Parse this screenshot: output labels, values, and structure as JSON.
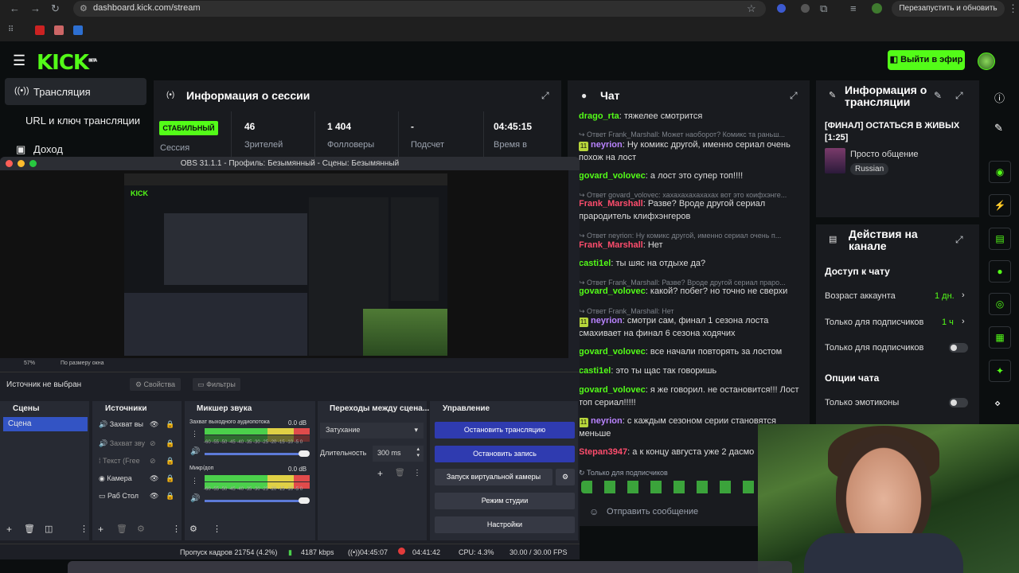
{
  "browser": {
    "url": "dashboard.kick.com/stream",
    "restart_label": "Перезапустить и обновить"
  },
  "kick": {
    "logo": "KICK",
    "logo_badge": "BETA",
    "go_live": "Выйти в эфир"
  },
  "nav": {
    "items": [
      {
        "label": "Трансляция",
        "icon": "broadcast-icon"
      },
      {
        "label": "URL и ключ трансляции"
      },
      {
        "label": "Доход",
        "icon": "money-icon"
      }
    ]
  },
  "session": {
    "title": "Информация о сессии",
    "status": "СТАБИЛЬНЫЙ",
    "status_label": "Сессия",
    "stats": [
      {
        "value": "46",
        "label": "Зрителей"
      },
      {
        "value": "1 404",
        "label": "Фолловеры"
      },
      {
        "value": "-",
        "label": "Подсчет"
      },
      {
        "value": "04:45:15",
        "label": "Время в"
      }
    ]
  },
  "chat": {
    "title": "Чат",
    "send_placeholder": "Отправить сообщение",
    "subs_only_note": "Только для подписчиков",
    "messages": [
      {
        "user": "drago_rta",
        "text": "тяжелее смотрится"
      },
      {
        "reply": "Ответ Frank_Marshall: Может наоборот? Комикс та раньш...",
        "badge": "11",
        "user": "neyrion",
        "text": "Ну комикс другой, именно сериал очень похож на лост"
      },
      {
        "user": "govard_volovec",
        "text": "а лост это супер топ!!!!"
      },
      {
        "reply": "Ответ govard_volovec: хахахахахахахах вот это коифхэнге...",
        "user": "Frank_Marshall",
        "text": "Разве? Вроде другой сериал прародитель клифхэнгеров"
      },
      {
        "reply": "Ответ neyrion: Ну комикс другой, именно сериал очень п...",
        "user": "Frank_Marshall",
        "text": "Нет"
      },
      {
        "user": "casti1el",
        "text": "ты шяс на отдыхе да?"
      },
      {
        "reply": "Ответ Frank_Marshall: Разве? Вроде другой сериал прaро...",
        "user": "govard_volovec",
        "text": "какой? побег? но точно не сверхи"
      },
      {
        "reply": "Ответ Frank_Marshall: Нет",
        "badge": "11",
        "user": "neyrion",
        "text": "смотри сам, финал 1 сезона лоста смахивает на финал 6 сезона ходячих"
      },
      {
        "user": "govard_volovec",
        "text": "все начали повторять за лостом"
      },
      {
        "user": "casti1el",
        "text": "это ты щас так говоришь"
      },
      {
        "user": "govard_volovec",
        "text": "я же говорил. не остановится!!! Лост топ сериал!!!!!"
      },
      {
        "badge": "11",
        "user": "neyrion",
        "text": "с каждым сезоном серии становятся меньше"
      },
      {
        "user": "Stepan3947",
        "text": "а к концу августа уже 2 дасмо"
      }
    ]
  },
  "stream_info": {
    "title": "Информация о трансляции",
    "stream_title": "[ФИНАЛ] ОСТАТЬСЯ В ЖИВЫХ [1:25]",
    "category": "Просто общение",
    "language": "Russian"
  },
  "channel_actions": {
    "title": "Действия на канале",
    "chat_access": "Доступ к чату",
    "rows": [
      {
        "label": "Возраст аккаунта",
        "value": "1 дн."
      },
      {
        "label": "Только для подписчиков",
        "value": "1 ч"
      },
      {
        "label": "Только для подписчиков",
        "value": ""
      }
    ],
    "chat_options": "Опции чата",
    "emotes_only": "Только эмотиконы"
  },
  "obs": {
    "title": "OBS 31.1.1 - Профиль: Безымянный - Сцены: Безымянный",
    "zoom": "57%",
    "fit": "По размеру окна",
    "no_source": "Источник не выбран",
    "properties": "Свойства",
    "filters": "Фильтры",
    "scenes_title": "Сцены",
    "scene": "Сцена",
    "sources_title": "Источники",
    "sources": [
      "Захват вы",
      "Захват зву",
      "Текст (Free",
      "Камера",
      "Раб Стол"
    ],
    "mixer_title": "Микшер звука",
    "mixer": [
      {
        "name": "Захват выходного аудиопотока",
        "db": "0.0 dB"
      },
      {
        "name": "Микр/доп",
        "db": "0.0 dB"
      }
    ],
    "scale": "-60 -55 -50 -45 -40 -35 -30 -25 -20 -15 -10 -5 0",
    "transitions_title": "Переходы между сцена...",
    "transition": "Затухание",
    "duration_label": "Длительность",
    "duration": "300 ms",
    "controls_title": "Управление",
    "controls": [
      "Остановить трансляцию",
      "Остановить запись",
      "Запуск виртуальной камеры",
      "Режим студии",
      "Настройки"
    ],
    "status": {
      "dropped": "Пропуск кадров 21754 (4.2%)",
      "kbps": "4187 kbps",
      "live_time": "04:45:07",
      "rec_time": "04:41:42",
      "cpu": "CPU: 4.3%",
      "fps": "30.00 / 30.00 FPS"
    }
  },
  "colors": {
    "kick_green": "#53fc18",
    "panel": "#191b1f",
    "obs_blue": "#2f3bb0"
  }
}
